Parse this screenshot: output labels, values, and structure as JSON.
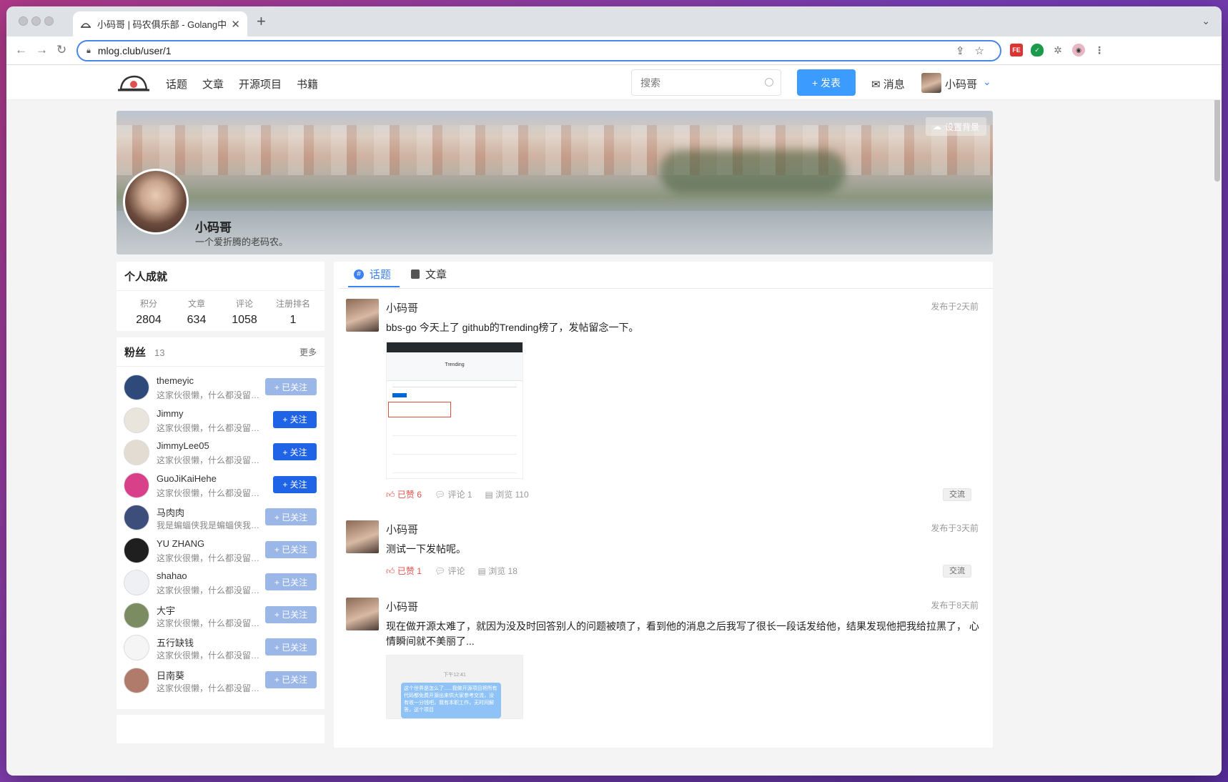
{
  "browser": {
    "tab_title": "小码哥 | 码农俱乐部 - Golang中国",
    "tab_close": "✕",
    "new_tab": "+",
    "tab_menu": "⌄",
    "url": "mlog.club/user/1"
  },
  "nav": {
    "links": [
      "话题",
      "文章",
      "开源项目",
      "书籍"
    ],
    "search_placeholder": "搜索",
    "post_button": "+ 发表",
    "messages": "✉ 消息",
    "username": "小码哥"
  },
  "profile": {
    "set_background": "设置背景",
    "name": "小码哥",
    "bio": "一个爱折腾的老码农。"
  },
  "achievements": {
    "title": "个人成就",
    "stats": [
      {
        "label": "积分",
        "value": "2804"
      },
      {
        "label": "文章",
        "value": "634"
      },
      {
        "label": "评论",
        "value": "1058"
      },
      {
        "label": "注册排名",
        "value": "1"
      }
    ]
  },
  "fans": {
    "title": "粉丝",
    "count": "13",
    "more": "更多",
    "items": [
      {
        "name": "themeyic",
        "desc": "这家伙很懒，什么都没留下…",
        "button": "+ 已关注",
        "following": true,
        "avatar_color": "#2e4a7a"
      },
      {
        "name": "Jimmy",
        "desc": "这家伙很懒，什么都没留下这…",
        "button": "+ 关注",
        "following": false,
        "avatar_color": "#e9e4dc"
      },
      {
        "name": "JimmyLee05",
        "desc": "这家伙很懒，什么都没留下这…",
        "button": "+ 关注",
        "following": false,
        "avatar_color": "#e2dcd2"
      },
      {
        "name": "GuoJiKaiHehe",
        "desc": "这家伙很懒，什么都没留下这…",
        "button": "+ 关注",
        "following": false,
        "avatar_color": "#d9408a"
      },
      {
        "name": "马肉肉",
        "desc": "我是蝙蝠侠我是蝙蝠侠我是…",
        "button": "+ 已关注",
        "following": true,
        "avatar_color": "#3d4e7a"
      },
      {
        "name": "YU ZHANG",
        "desc": "这家伙很懒，什么都没留下…",
        "button": "+ 已关注",
        "following": true,
        "avatar_color": "#1f1f1f"
      },
      {
        "name": "shahao",
        "desc": "这家伙很懒，什么都没留下…",
        "button": "+ 已关注",
        "following": true,
        "avatar_color": "#eef0f3"
      },
      {
        "name": "大宇",
        "desc": "这家伙很懒，什么都没留下…",
        "button": "+ 已关注",
        "following": true,
        "avatar_color": "#7b8c62"
      },
      {
        "name": "五行缺钱",
        "desc": "这家伙很懒，什么都没留下…",
        "button": "+ 已关注",
        "following": true,
        "avatar_color": "#f5f5f5"
      },
      {
        "name": "日南葵",
        "desc": "这家伙很懒，什么都没留下…",
        "button": "+ 已关注",
        "following": true,
        "avatar_color": "#b07b6a"
      }
    ]
  },
  "content_tabs": [
    "话题",
    "文章"
  ],
  "posts": [
    {
      "author": "小码哥",
      "time": "发布于2天前",
      "text": "bbs-go 今天上了 github的Trending榜了，发帖留念一下。",
      "like": "已赞 6",
      "comment": "评论 1",
      "view": "浏览 110",
      "tag": "交流",
      "screenshot_title": "Trending"
    },
    {
      "author": "小码哥",
      "time": "发布于3天前",
      "text": "测试一下发帖呢。",
      "like": "已赞 1",
      "comment": "评论",
      "view": "浏览 18",
      "tag": "交流"
    },
    {
      "author": "小码哥",
      "time": "发布于8天前",
      "text": "现在做开源太难了，就因为没及时回答别人的问题被喷了，看到他的消息之后我写了很长一段话发给他，结果发现他把我给拉黑了， 心情瞬间就不美丽了...",
      "chat_time": "下午12:41",
      "chat_text": "这个世界是怎么了......我做开源项目将所有代码都免费开源出来供大家参考交流，没有收一分钱吧，我有本职工作，无时间解答，这个项目"
    }
  ],
  "colors": {
    "accent": "#3b82f6",
    "primary_button": "#1f64e6",
    "followed_button": "#9bb7e8",
    "liked": "#e4504b"
  }
}
